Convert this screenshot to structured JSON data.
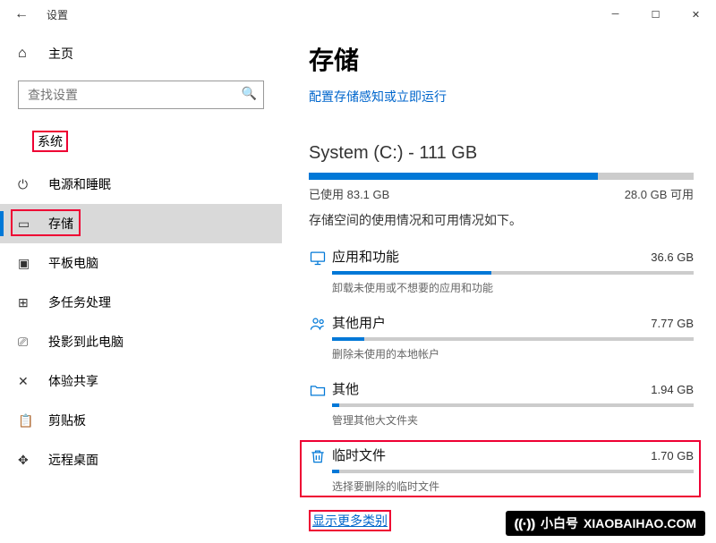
{
  "window": {
    "title": "设置",
    "back": "←"
  },
  "sidebar": {
    "home_label": "主页",
    "search_placeholder": "查找设置",
    "group_label": "系统",
    "items": [
      {
        "label": "电源和睡眠"
      },
      {
        "label": "存储"
      },
      {
        "label": "平板电脑"
      },
      {
        "label": "多任务处理"
      },
      {
        "label": "投影到此电脑"
      },
      {
        "label": "体验共享"
      },
      {
        "label": "剪贴板"
      },
      {
        "label": "远程桌面"
      }
    ]
  },
  "main": {
    "heading": "存储",
    "sense_link": "配置存储感知或立即运行",
    "drive_label": "System (C:) - 111 GB",
    "used_label": "已使用 83.1 GB",
    "free_label": "28.0 GB 可用",
    "used_pct": 75,
    "usage_desc": "存储空间的使用情况和可用情况如下。",
    "categories": [
      {
        "name": "应用和功能",
        "size": "36.6 GB",
        "pct": 44,
        "desc": "卸载未使用或不想要的应用和功能"
      },
      {
        "name": "其他用户",
        "size": "7.77 GB",
        "pct": 9,
        "desc": "删除未使用的本地帐户"
      },
      {
        "name": "其他",
        "size": "1.94 GB",
        "pct": 2,
        "desc": "管理其他大文件夹"
      },
      {
        "name": "临时文件",
        "size": "1.70 GB",
        "pct": 2,
        "desc": "选择要删除的临时文件"
      }
    ],
    "show_more": "显示更多类别"
  },
  "watermark": {
    "brand": "小白号",
    "domain": "XIAOBAIHAO.COM"
  }
}
